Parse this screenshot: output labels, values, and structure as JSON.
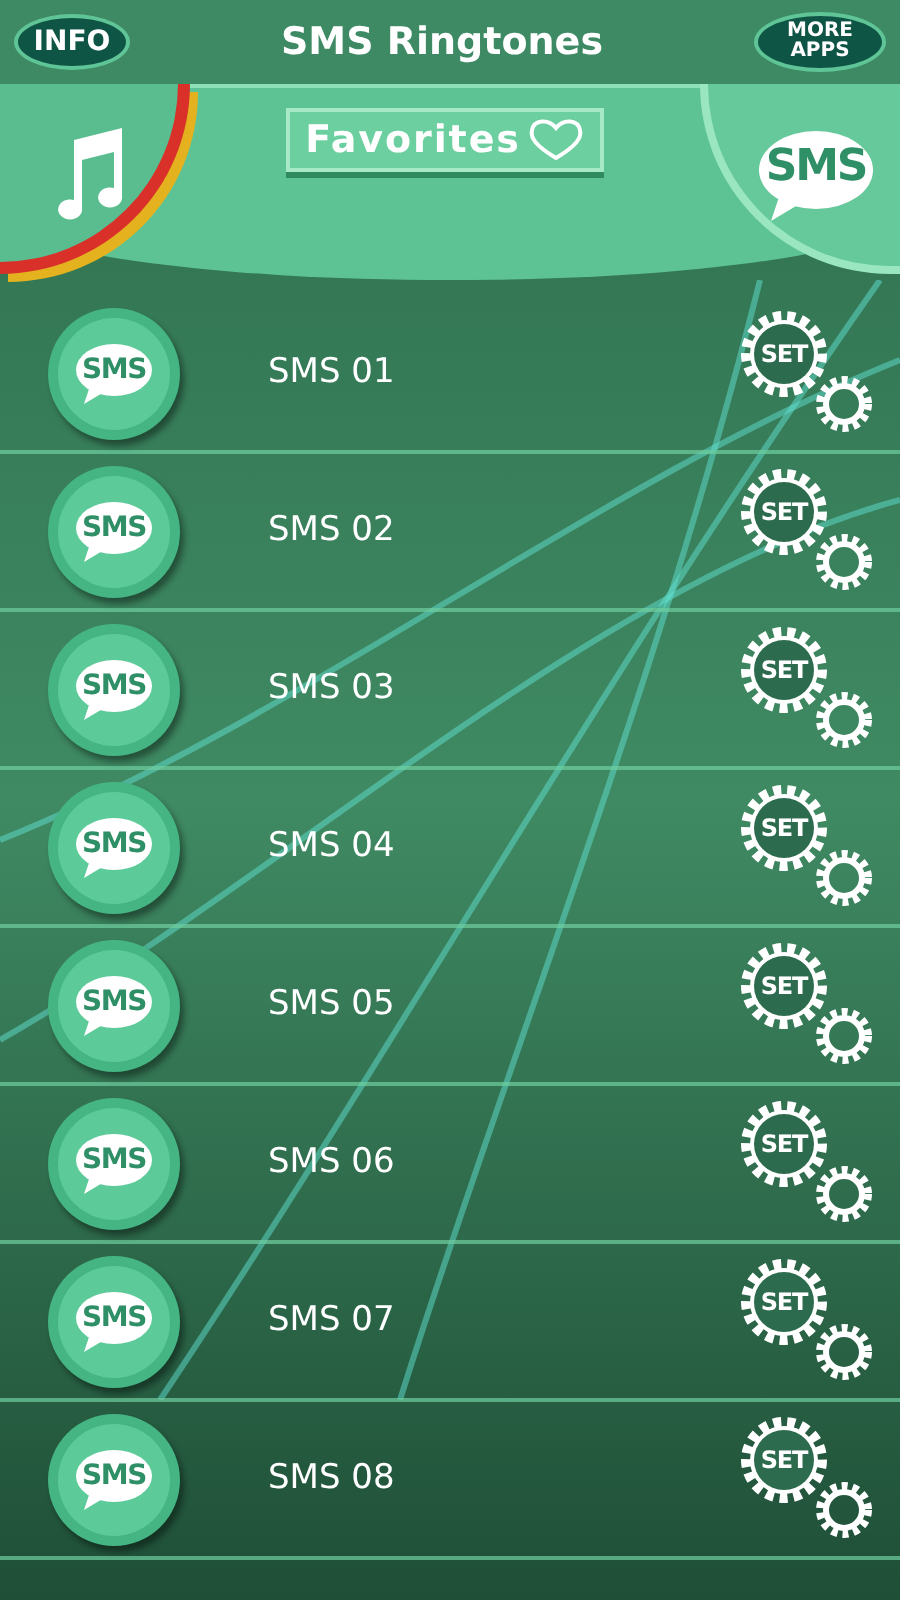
{
  "header": {
    "info_button": "INFO",
    "title": "SMS Ringtones",
    "more_apps_button": "MORE APPS"
  },
  "panel": {
    "favorites_button": "Favorites",
    "sms_badge": "SMS"
  },
  "rows": [
    {
      "label": "SMS 01",
      "icon_text": "SMS",
      "button": "SET"
    },
    {
      "label": "SMS 02",
      "icon_text": "SMS",
      "button": "SET"
    },
    {
      "label": "SMS 03",
      "icon_text": "SMS",
      "button": "SET"
    },
    {
      "label": "SMS 04",
      "icon_text": "SMS",
      "button": "SET"
    },
    {
      "label": "SMS 05",
      "icon_text": "SMS",
      "button": "SET"
    },
    {
      "label": "SMS 06",
      "icon_text": "SMS",
      "button": "SET"
    },
    {
      "label": "SMS 07",
      "icon_text": "SMS",
      "button": "SET"
    },
    {
      "label": "SMS 08",
      "icon_text": "SMS",
      "button": "SET"
    }
  ]
}
